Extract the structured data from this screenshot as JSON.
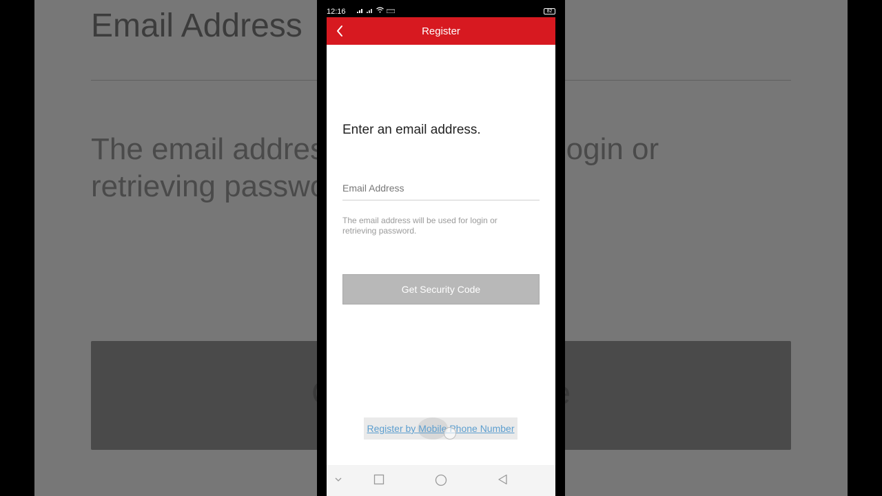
{
  "status_bar": {
    "time": "12:16",
    "battery": "82"
  },
  "app_bar": {
    "title": "Register"
  },
  "form": {
    "heading": "Enter an email address.",
    "email_placeholder": "Email Address",
    "email_value": "",
    "hint": "The email address will be used for login or retrieving password.",
    "submit_label": "Get Security Code",
    "alt_link": "Register by Mobile Phone Number"
  },
  "background_echo": {
    "title": "Email Address",
    "hint": "The email address will be used for login or retrieving password.",
    "button": "Get Security Code"
  },
  "colors": {
    "brand": "#d71920",
    "disabled_button": "#b8b8b8",
    "link": "#5c9ecf"
  },
  "icons": {
    "back": "chevron-left-icon",
    "signal": "signal-icon",
    "wifi": "wifi-icon",
    "nav_down": "chevron-down-icon",
    "nav_recent": "square-icon",
    "nav_home": "circle-icon",
    "nav_back": "triangle-back-icon"
  }
}
